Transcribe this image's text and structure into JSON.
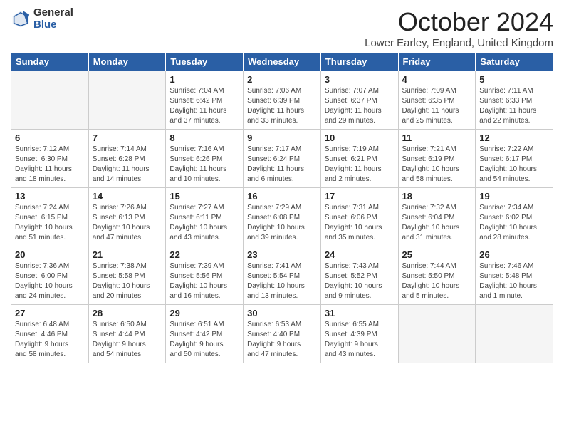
{
  "header": {
    "logo_general": "General",
    "logo_blue": "Blue",
    "month": "October 2024",
    "location": "Lower Earley, England, United Kingdom"
  },
  "days_of_week": [
    "Sunday",
    "Monday",
    "Tuesday",
    "Wednesday",
    "Thursday",
    "Friday",
    "Saturday"
  ],
  "weeks": [
    [
      {
        "day": "",
        "info": ""
      },
      {
        "day": "",
        "info": ""
      },
      {
        "day": "1",
        "info": "Sunrise: 7:04 AM\nSunset: 6:42 PM\nDaylight: 11 hours\nand 37 minutes."
      },
      {
        "day": "2",
        "info": "Sunrise: 7:06 AM\nSunset: 6:39 PM\nDaylight: 11 hours\nand 33 minutes."
      },
      {
        "day": "3",
        "info": "Sunrise: 7:07 AM\nSunset: 6:37 PM\nDaylight: 11 hours\nand 29 minutes."
      },
      {
        "day": "4",
        "info": "Sunrise: 7:09 AM\nSunset: 6:35 PM\nDaylight: 11 hours\nand 25 minutes."
      },
      {
        "day": "5",
        "info": "Sunrise: 7:11 AM\nSunset: 6:33 PM\nDaylight: 11 hours\nand 22 minutes."
      }
    ],
    [
      {
        "day": "6",
        "info": "Sunrise: 7:12 AM\nSunset: 6:30 PM\nDaylight: 11 hours\nand 18 minutes."
      },
      {
        "day": "7",
        "info": "Sunrise: 7:14 AM\nSunset: 6:28 PM\nDaylight: 11 hours\nand 14 minutes."
      },
      {
        "day": "8",
        "info": "Sunrise: 7:16 AM\nSunset: 6:26 PM\nDaylight: 11 hours\nand 10 minutes."
      },
      {
        "day": "9",
        "info": "Sunrise: 7:17 AM\nSunset: 6:24 PM\nDaylight: 11 hours\nand 6 minutes."
      },
      {
        "day": "10",
        "info": "Sunrise: 7:19 AM\nSunset: 6:21 PM\nDaylight: 11 hours\nand 2 minutes."
      },
      {
        "day": "11",
        "info": "Sunrise: 7:21 AM\nSunset: 6:19 PM\nDaylight: 10 hours\nand 58 minutes."
      },
      {
        "day": "12",
        "info": "Sunrise: 7:22 AM\nSunset: 6:17 PM\nDaylight: 10 hours\nand 54 minutes."
      }
    ],
    [
      {
        "day": "13",
        "info": "Sunrise: 7:24 AM\nSunset: 6:15 PM\nDaylight: 10 hours\nand 51 minutes."
      },
      {
        "day": "14",
        "info": "Sunrise: 7:26 AM\nSunset: 6:13 PM\nDaylight: 10 hours\nand 47 minutes."
      },
      {
        "day": "15",
        "info": "Sunrise: 7:27 AM\nSunset: 6:11 PM\nDaylight: 10 hours\nand 43 minutes."
      },
      {
        "day": "16",
        "info": "Sunrise: 7:29 AM\nSunset: 6:08 PM\nDaylight: 10 hours\nand 39 minutes."
      },
      {
        "day": "17",
        "info": "Sunrise: 7:31 AM\nSunset: 6:06 PM\nDaylight: 10 hours\nand 35 minutes."
      },
      {
        "day": "18",
        "info": "Sunrise: 7:32 AM\nSunset: 6:04 PM\nDaylight: 10 hours\nand 31 minutes."
      },
      {
        "day": "19",
        "info": "Sunrise: 7:34 AM\nSunset: 6:02 PM\nDaylight: 10 hours\nand 28 minutes."
      }
    ],
    [
      {
        "day": "20",
        "info": "Sunrise: 7:36 AM\nSunset: 6:00 PM\nDaylight: 10 hours\nand 24 minutes."
      },
      {
        "day": "21",
        "info": "Sunrise: 7:38 AM\nSunset: 5:58 PM\nDaylight: 10 hours\nand 20 minutes."
      },
      {
        "day": "22",
        "info": "Sunrise: 7:39 AM\nSunset: 5:56 PM\nDaylight: 10 hours\nand 16 minutes."
      },
      {
        "day": "23",
        "info": "Sunrise: 7:41 AM\nSunset: 5:54 PM\nDaylight: 10 hours\nand 13 minutes."
      },
      {
        "day": "24",
        "info": "Sunrise: 7:43 AM\nSunset: 5:52 PM\nDaylight: 10 hours\nand 9 minutes."
      },
      {
        "day": "25",
        "info": "Sunrise: 7:44 AM\nSunset: 5:50 PM\nDaylight: 10 hours\nand 5 minutes."
      },
      {
        "day": "26",
        "info": "Sunrise: 7:46 AM\nSunset: 5:48 PM\nDaylight: 10 hours\nand 1 minute."
      }
    ],
    [
      {
        "day": "27",
        "info": "Sunrise: 6:48 AM\nSunset: 4:46 PM\nDaylight: 9 hours\nand 58 minutes."
      },
      {
        "day": "28",
        "info": "Sunrise: 6:50 AM\nSunset: 4:44 PM\nDaylight: 9 hours\nand 54 minutes."
      },
      {
        "day": "29",
        "info": "Sunrise: 6:51 AM\nSunset: 4:42 PM\nDaylight: 9 hours\nand 50 minutes."
      },
      {
        "day": "30",
        "info": "Sunrise: 6:53 AM\nSunset: 4:40 PM\nDaylight: 9 hours\nand 47 minutes."
      },
      {
        "day": "31",
        "info": "Sunrise: 6:55 AM\nSunset: 4:39 PM\nDaylight: 9 hours\nand 43 minutes."
      },
      {
        "day": "",
        "info": ""
      },
      {
        "day": "",
        "info": ""
      }
    ]
  ]
}
